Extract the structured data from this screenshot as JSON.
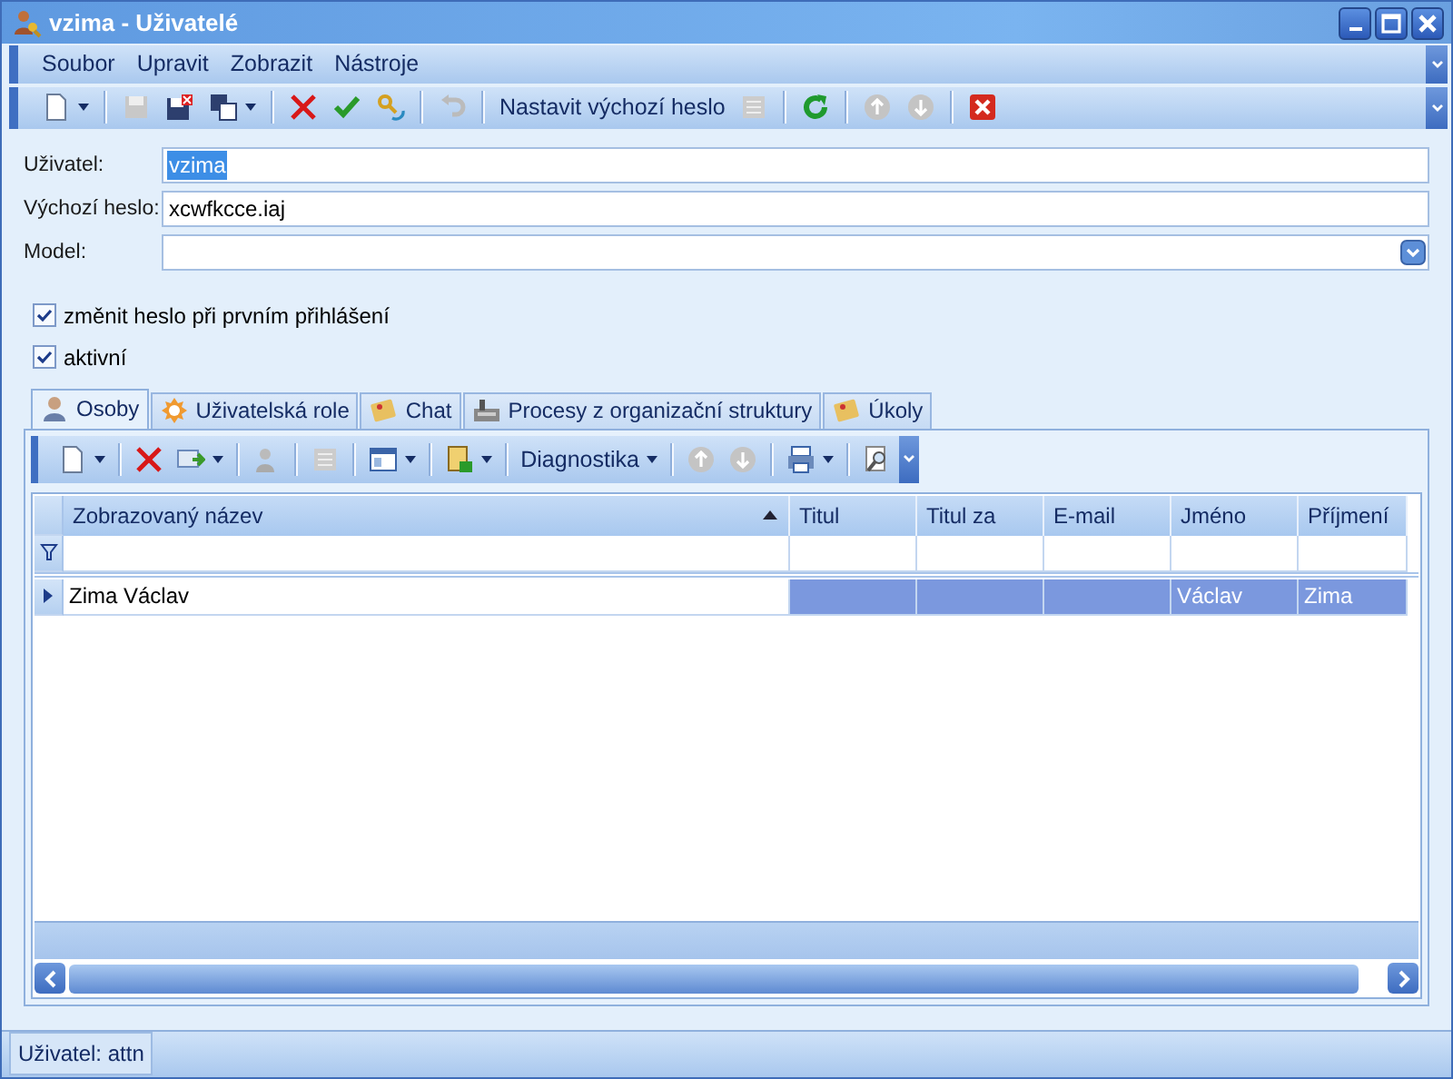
{
  "window": {
    "title": "vzima - Uživatelé"
  },
  "menu": [
    "Soubor",
    "Upravit",
    "Zobrazit",
    "Nástroje"
  ],
  "toolbar": {
    "action_label": "Nastavit výchozí heslo"
  },
  "form": {
    "fields": [
      {
        "label": "Uživatel:",
        "value": "vzima",
        "kind": "text",
        "text_selected": true
      },
      {
        "label": "Výchozí heslo:",
        "value": "xcwfkcce.iaj",
        "kind": "text",
        "text_selected": false
      },
      {
        "label": "Model:",
        "kind": "dropdown"
      }
    ],
    "checkboxes": [
      {
        "label": "změnit heslo při prvním přihlášení",
        "checked": true
      },
      {
        "label": "aktivní",
        "checked": true
      }
    ]
  },
  "tabs": [
    {
      "label": "Osoby",
      "selected": true
    },
    {
      "label": "Uživatelská role",
      "selected": false
    },
    {
      "label": "Chat",
      "selected": false
    },
    {
      "label": "Procesy z organizační struktury",
      "selected": false
    },
    {
      "label": "Úkoly",
      "selected": false
    }
  ],
  "grid_toolbar": {
    "label": "Diagnostika"
  },
  "table": {
    "columns": [
      {
        "label": "Zobrazovaný název",
        "sorted": true
      },
      {
        "label": "Titul",
        "sorted": false
      },
      {
        "label": "Titul za",
        "sorted": false
      },
      {
        "label": "E-mail",
        "sorted": false
      },
      {
        "label": "Jméno",
        "sorted": false
      },
      {
        "label": "Příjmení",
        "sorted": false
      }
    ],
    "rows": [
      {
        "cells": [
          "Zima Václav",
          "",
          "",
          "",
          "Václav",
          "Zima"
        ],
        "selected": true
      }
    ]
  },
  "status_bar": {
    "text": "Uživatel: attn"
  }
}
